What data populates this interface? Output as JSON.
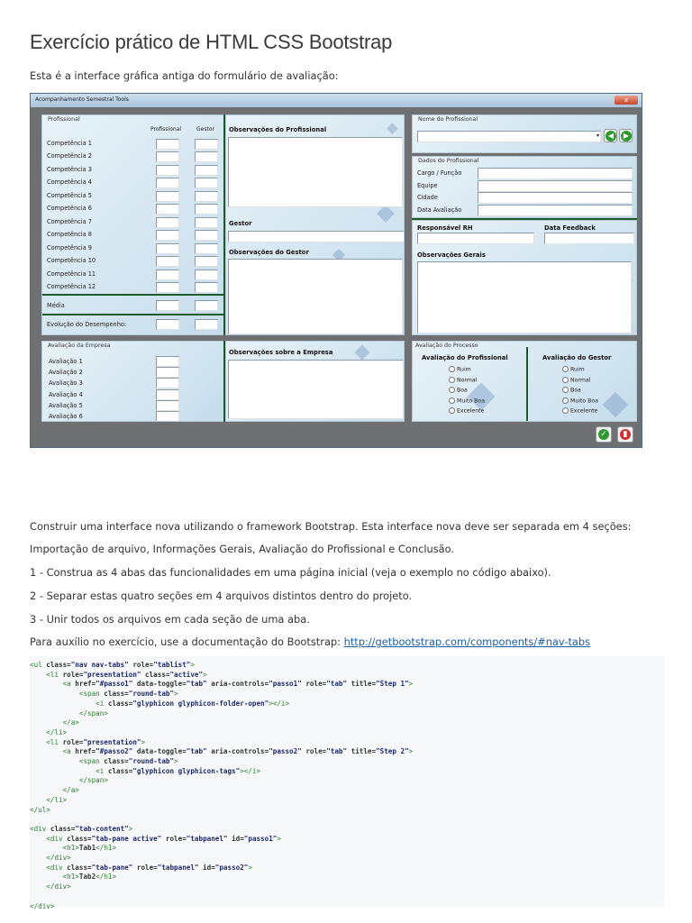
{
  "page": {
    "title": "Exercício prático de HTML CSS Bootstrap",
    "intro": "Esta é a interface gráfica antiga do formulário de avaliação:",
    "paragraphs": [
      "Construir uma interface nova utilizando o framework Bootstrap. Esta interface nova deve ser separada em 4 seções:",
      "Importação de arquivo, Informações Gerais, Avaliação do Profissional e Conclusão.",
      "1 - Construa as 4 abas das funcionalidades em uma página inicial (veja o exemplo no código abaixo).",
      "2 - Separar estas quatro seções em 4 arquivos distintos dentro do projeto.",
      "3 - Unir todos os arquivos em cada seção de uma aba."
    ],
    "help_text": "Para auxílio no exercício, use a documentação do Bootstrap: ",
    "help_link": "http://getbootstrap.com/components/#nav-tabs"
  },
  "window": {
    "title": "Acompanhamento Semestral Tools",
    "close_label": "x",
    "profissional_group": "Profissional",
    "col_profissional": "Profissional",
    "col_gestor": "Gestor",
    "competencias": [
      "Competência 1",
      "Competência 2",
      "Competência 3",
      "Competência 4",
      "Competência 5",
      "Competência 6",
      "Competência 7",
      "Competência 8",
      "Competência 9",
      "Competência 10",
      "Competência 11",
      "Competência 12"
    ],
    "media": "Média",
    "evolucao": "Evolução do Desempenho:",
    "obs_profissional": "Observações do Profissional",
    "gestor": "Gestor",
    "obs_gestor": "Observações do Gestor",
    "nome_group": "Nome do Profissional",
    "dados_group": "Dados do Profissional",
    "dados_fields": [
      "Cargo / Função",
      "Equipe",
      "Cidade",
      "Data Avaliação"
    ],
    "responsavel_rh": "Responsável RH",
    "data_feedback": "Data Feedback",
    "obs_gerais": "Observações Gerais",
    "empresa_group": "Avaliação da Empresa",
    "avaliacoes": [
      "Avaliação 1",
      "Avaliação 2",
      "Avaliação 3",
      "Avaliação 4",
      "Avaliação 5",
      "Avaliação 6"
    ],
    "obs_empresa": "Observações sobre a Empresa",
    "processo_group": "Avaliação do Processo",
    "aval_profissional": "Avaliação do Profissional",
    "aval_gestor": "Avaliação do Gestor",
    "options": [
      "Ruim",
      "Normal",
      "Boa",
      "Muito Boa",
      "Excelente"
    ],
    "colors": {
      "green_divider": "#1d5c2a",
      "confirm": "#2e9a2e",
      "delete": "#d03030"
    }
  },
  "code_lines": [
    "<ul class=\"nav nav-tabs\" role=\"tablist\">",
    "    <li role=\"presentation\" class=\"active\">",
    "        <a href=\"#passo1\" data-toggle=\"tab\" aria-controls=\"passo1\" role=\"tab\" title=\"Step 1\">",
    "            <span class=\"round-tab\">",
    "                <i class=\"glyphicon glyphicon-folder-open\"></i>",
    "            </span>",
    "        </a>",
    "    </li>",
    "    <li role=\"presentation\">",
    "        <a href=\"#passo2\" data-toggle=\"tab\" aria-controls=\"passo2\" role=\"tab\" title=\"Step 2\">",
    "            <span class=\"round-tab\">",
    "                <i class=\"glyphicon glyphicon-tags\"></i>",
    "            </span>",
    "        </a>",
    "    </li>",
    "</ul>",
    "",
    "<div class=\"tab-content\">",
    "    <div class=\"tab-pane active\" role=\"tabpanel\" id=\"passo1\">",
    "        <h1>Tab1</h1>",
    "    </div>",
    "    <div class=\"tab-pane\" role=\"tabpanel\" id=\"passo2\">",
    "        <h1>Tab2</h1>",
    "    </div>",
    "",
    "</div>"
  ]
}
